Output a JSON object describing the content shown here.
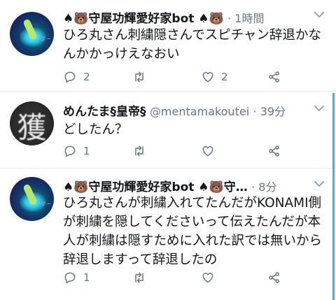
{
  "tweets": [
    {
      "name": "♠🐻守屋功輝愛好家bot ♠🐻",
      "handle": "",
      "time": "· 1時間",
      "text": "ひろ丸さん刺繍隠さんでスピチャン辞退かなんかかっけえなおい",
      "replies": "2",
      "retweets": "",
      "likes": "2",
      "avatar": "gamer-avatar"
    },
    {
      "name": "めんたま§皇帝§",
      "handle": "@mentamakoutei",
      "time": "· 39分",
      "text": "どしたん？",
      "replies": "1",
      "retweets": "",
      "likes": "",
      "avatar": "kanji-avatar",
      "avatar_char": "獲"
    },
    {
      "name": "♠🐻守屋功輝愛好家bot ♠🐻守…",
      "handle": "",
      "time": "· 8分",
      "text": "ひろ丸さんが刺繍入れてたんだがKONAMI側が刺繍を隠してくださいって伝えたんだが本人が刺繍は隠すために入れた訳では無いから辞退しますって辞退したの",
      "replies": "1",
      "retweets": "",
      "likes": "",
      "avatar": "gamer-avatar"
    }
  ],
  "colors": {
    "accent": "#1da1f2",
    "muted": "#657786",
    "text": "#14171a",
    "divider": "#e6ecf0"
  },
  "icons": [
    "reply-icon",
    "retweet-icon",
    "like-icon",
    "share-icon",
    "chevron-down-icon"
  ]
}
